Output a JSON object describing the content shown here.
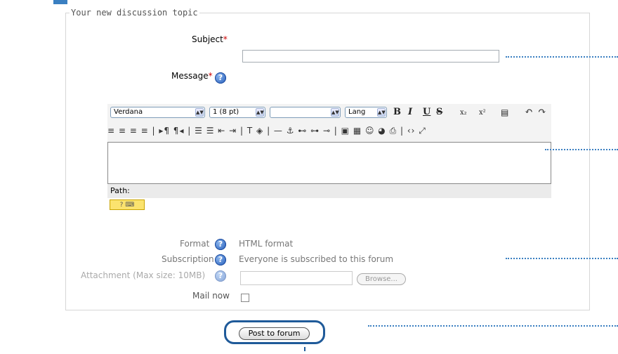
{
  "legend": "Your new discussion topic",
  "subject": {
    "label": "Subject",
    "required_mark": "*",
    "value": ""
  },
  "message": {
    "label": "Message",
    "required_mark": "*",
    "help": "?"
  },
  "toolbar": {
    "font_family": "Verdana",
    "font_size": "1 (8 pt)",
    "heading": "",
    "lang": "Lang",
    "bold": "B",
    "italic": "I",
    "underline": "U",
    "strike": "S",
    "subscript": "x₂",
    "superscript": "x²",
    "row2_glyphs": "≡ ≡ ≡ ≡ | ▸¶ ¶◂ | ☰ ☰ ⇤ ⇥ | T ◈ | — ⚓ ⊷ ⊶ ⊸ | ▣ ▦ ☺ ◕ ⎙ | ‹› ⤢"
  },
  "path_label": "Path:",
  "format": {
    "label": "Format",
    "value": "HTML format"
  },
  "subscription": {
    "label": "Subscription",
    "value": "Everyone is subscribed to this forum"
  },
  "attachment": {
    "label": "Attachment (Max size: 10MB)",
    "browse": "Browse..."
  },
  "mail_now": {
    "label": "Mail now"
  },
  "submit": "Post to forum"
}
